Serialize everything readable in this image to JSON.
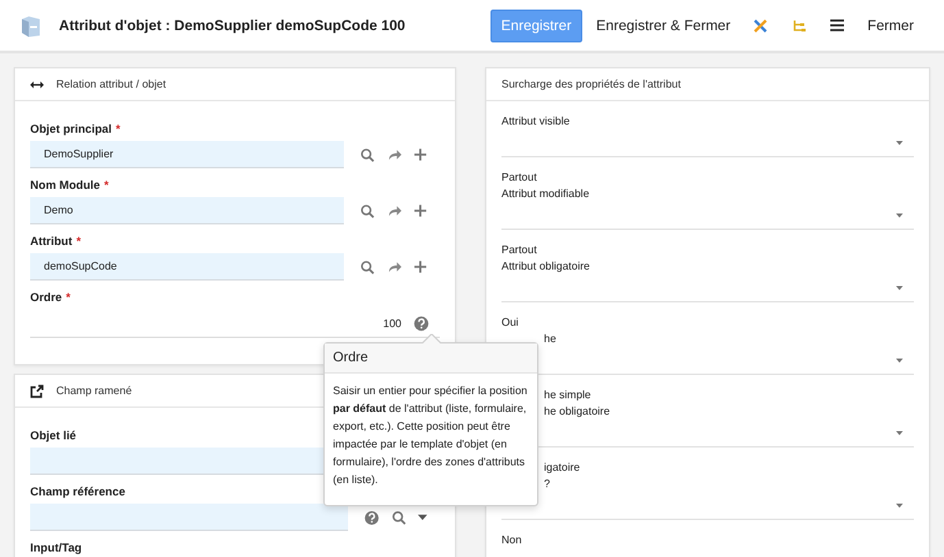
{
  "header": {
    "title": "Attribut d'objet : DemoSupplier demoSupCode 100",
    "actions": [
      {
        "kind": "primary",
        "label": "Enregistrer"
      },
      {
        "kind": "plain",
        "label": "Enregistrer & Fermer"
      },
      {
        "kind": "cross"
      },
      {
        "kind": "tree"
      },
      {
        "kind": "menu"
      },
      {
        "kind": "plain",
        "label": "Fermer"
      }
    ]
  },
  "left_panels": [
    {
      "title": "Relation attribut / objet",
      "fields": [
        {
          "label": "Objet principal",
          "required_mark": "*",
          "kind": "link",
          "value": "DemoSupplier"
        },
        {
          "label": "Nom Module",
          "required_mark": "*",
          "kind": "link",
          "value": "Demo"
        },
        {
          "label": "Attribut",
          "required_mark": "*",
          "kind": "link",
          "value": "demoSupCode"
        },
        {
          "label": "Ordre",
          "required_mark": "*",
          "kind": "number",
          "value": "100"
        }
      ]
    },
    {
      "title": "Champ ramené",
      "fields": [
        {
          "label": "Objet lié",
          "kind": "plain"
        },
        {
          "label": "Champ référence",
          "kind": "select"
        },
        {
          "label": "Input/Tag",
          "kind": "label"
        }
      ]
    }
  ],
  "tooltip": {
    "title": "Ordre",
    "text": "Saisir un entier pour spécifier la position **par défaut** de l'attribut (liste, formulaire, export, etc.). Cette position peut être impactée par le template d'objet (en formulaire), l'ordre des zones d'attributs (en liste)."
  },
  "right_panel": {
    "title": "Surcharge des propriétés de l'attribut",
    "fields": [
      {
        "lines": [
          "Attribut visible"
        ]
      },
      {
        "lines": [
          "Partout",
          "Attribut modifiable"
        ]
      },
      {
        "lines": [
          "Partout",
          "Attribut obligatoire"
        ]
      },
      {
        "lines": [
          "Oui",
          "he"
        ]
      },
      {
        "lines": [
          "he simple",
          "he obligatoire"
        ]
      },
      {
        "lines": [
          "igatoire",
          "?"
        ]
      }
    ],
    "last_field": {
      "lines": [
        "Non"
      ]
    }
  }
}
